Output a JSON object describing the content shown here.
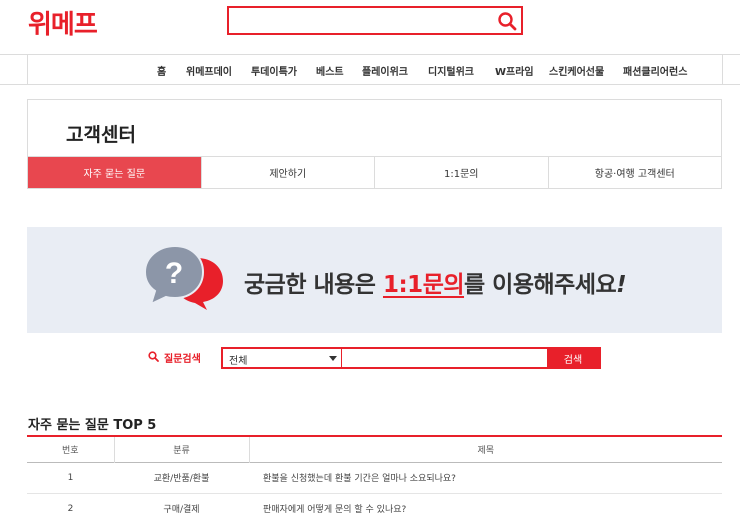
{
  "header": {
    "logo_text": "위메프",
    "search_placeholder": "",
    "search_icon": "search-icon"
  },
  "nav": {
    "items": [
      "홈",
      "위메프데이",
      "투데이특가",
      "베스트",
      "플레이위크",
      "디지털위크",
      "W프라임",
      "스킨케어선물",
      "패션클리어런스"
    ]
  },
  "cs": {
    "title": "고객센터",
    "tabs": [
      "자주 묻는 질문",
      "제안하기",
      "1:1문의",
      "항공·여행 고객센터"
    ],
    "active_tab": 0
  },
  "banner": {
    "icon": "question-chat-icon",
    "text_before": "궁금한 내용은 ",
    "highlight": "1:1문의",
    "text_after": "를 이용해주세요",
    "exclamation": "!"
  },
  "faq_search": {
    "label": "질문검색",
    "select_value": "전체",
    "input_value": "",
    "button_label": "검색"
  },
  "top5": {
    "title": "자주 묻는 질문 TOP 5",
    "columns": [
      "번호",
      "분류",
      "제목"
    ],
    "rows": [
      {
        "num": "1",
        "category": "교환/반품/환불",
        "subject": "환불을 신청했는데 환불 기간은 얼마나 소요되나요?"
      },
      {
        "num": "2",
        "category": "구매/결제",
        "subject": "판매자에게 어떻게 문의 할 수 있나요?"
      }
    ]
  },
  "colors": {
    "brand_red": "#e8202a",
    "tab_active": "#e8474f",
    "banner_bg": "#e9edf4",
    "icon_gray": "#8c96a8"
  }
}
